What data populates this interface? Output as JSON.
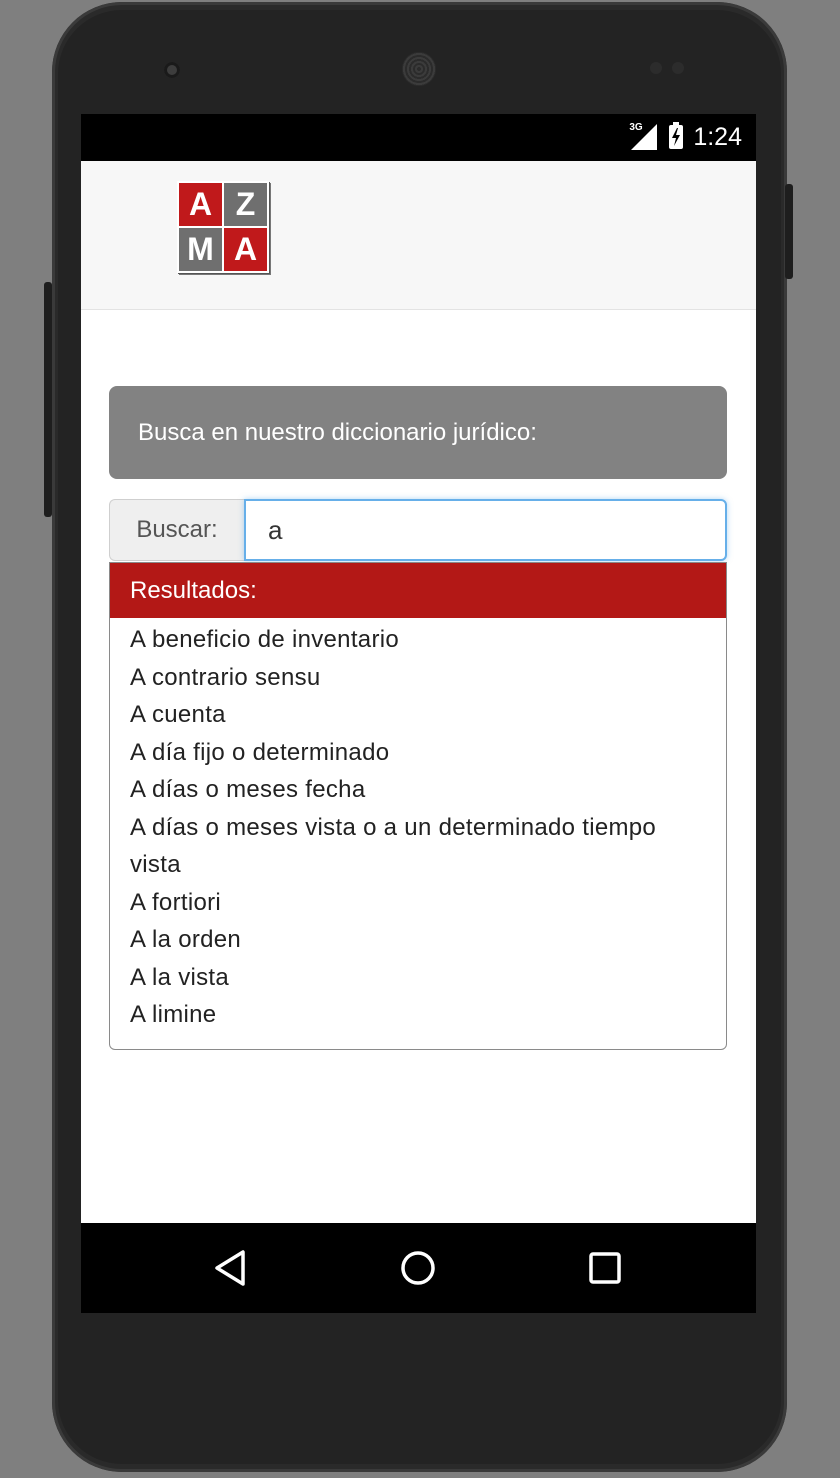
{
  "status_bar": {
    "network": "3G",
    "time": "1:24"
  },
  "logo": {
    "letters": [
      "A",
      "Z",
      "M",
      "A"
    ],
    "colors": [
      "#c0191b",
      "#6f6f6f",
      "#6f6f6f",
      "#c0191b"
    ]
  },
  "banner": {
    "text": "Busca en nuestro diccionario jurídico:"
  },
  "search": {
    "label": "Buscar:",
    "value": "a"
  },
  "results": {
    "header": "Resultados:",
    "items": [
      "A beneficio de inventario",
      "A contrario sensu",
      "A cuenta",
      "A día fijo o determinado",
      "A días o meses fecha",
      "A días o meses vista o a un determinado tiempo vista",
      "A fortiori",
      "A la orden",
      "A la vista",
      "A limine"
    ]
  },
  "nav_bar": {
    "icons": [
      "back-icon",
      "home-icon",
      "recents-icon"
    ]
  },
  "colors": {
    "accent_red": "#b31816",
    "banner_gray": "#828282",
    "focus_blue": "#66afe9"
  }
}
